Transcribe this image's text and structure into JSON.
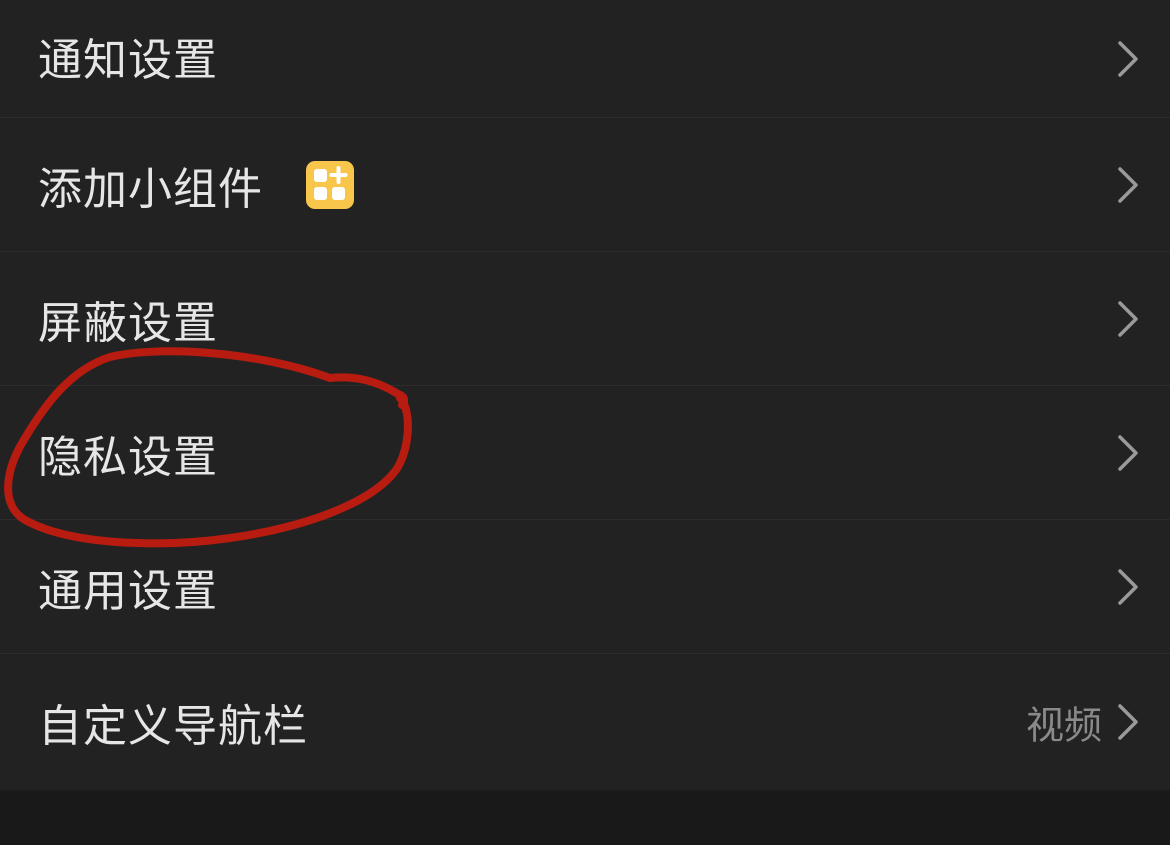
{
  "settings": {
    "items": [
      {
        "label": "通知设置"
      },
      {
        "label": "添加小组件",
        "icon": "widget-add-icon",
        "icon_color": "#f7c64a"
      },
      {
        "label": "屏蔽设置"
      },
      {
        "label": "隐私设置"
      },
      {
        "label": "通用设置"
      },
      {
        "label": "自定义导航栏",
        "value": "视频"
      }
    ]
  },
  "annotation": {
    "type": "hand-drawn-circle",
    "target": "隐私设置",
    "color": "#b81c10"
  }
}
